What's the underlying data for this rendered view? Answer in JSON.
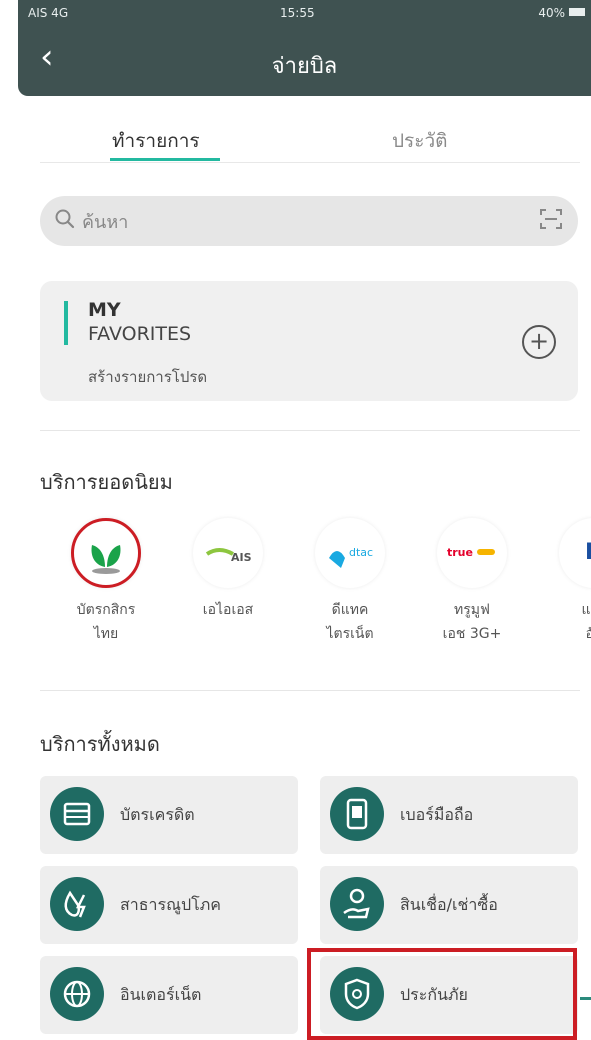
{
  "status_bar": {
    "carrier": "AIS 4G",
    "time": "15:55",
    "battery": "40%"
  },
  "header": {
    "back_icon": "chevron-left-icon",
    "title": "จ่ายบิล"
  },
  "tabs": [
    {
      "label": "ทำรายการ",
      "active": true
    },
    {
      "label": "ประวัติ",
      "active": false
    }
  ],
  "search": {
    "placeholder": "ค้นหา",
    "icon": "search-icon",
    "scan_icon": "scan-icon"
  },
  "favorites": {
    "title_line1": "MY",
    "title_line2": "FAVORITES",
    "subtitle": "สร้างรายการโปรด",
    "add_icon": "plus-circle-icon"
  },
  "popular": {
    "title": "บริการยอดนิยม",
    "items": [
      {
        "line1": "บัตรกสิกร",
        "line2": "ไทย",
        "logo_text": "",
        "logo_color": "#1aa34a",
        "highlighted": true
      },
      {
        "line1": "เอไอเอส",
        "line2": "",
        "logo_text": "AIS",
        "logo_color": "#8dc63f"
      },
      {
        "line1": "ดีแทค",
        "line2": "ไตรเน็ต",
        "logo_text": "dtac",
        "logo_color": "#19a9e1"
      },
      {
        "line1": "ทรูมูฟ",
        "line2": "เอช 3G+",
        "logo_text": "true",
        "logo_color": "#e4002b"
      },
      {
        "line1": "แอร์",
        "line2": "อัล",
        "logo_text": "P",
        "logo_color": "#1a4fa0"
      }
    ]
  },
  "all_services": {
    "title": "บริการทั้งหมด",
    "items": [
      {
        "label": "บัตรเครดิต",
        "icon": "credit-card-icon"
      },
      {
        "label": "เบอร์มือถือ",
        "icon": "mobile-phone-icon"
      },
      {
        "label": "สาธารณูปโภค",
        "icon": "utilities-icon"
      },
      {
        "label": "สินเชื่อ/เช่าซื้อ",
        "icon": "loan-icon"
      },
      {
        "label": "อินเตอร์เน็ต",
        "icon": "globe-icon"
      },
      {
        "label": "ประกันภัย",
        "icon": "shield-icon",
        "highlighted": true
      }
    ]
  },
  "colors": {
    "header_bg": "#3f5251",
    "accent": "#23b9a0",
    "highlight": "#cc1d24",
    "service_icon_bg": "#1f6b63"
  }
}
